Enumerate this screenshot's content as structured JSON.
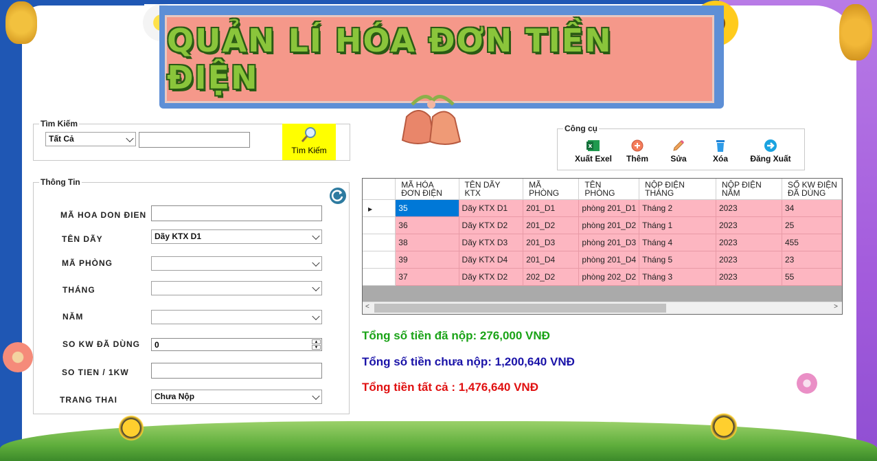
{
  "banner": {
    "title": "QUẢN LÍ HÓA ĐƠN TIỀN ĐIỆN"
  },
  "search": {
    "group_title": "Tìm Kiếm",
    "filter_value": "Tất Cả",
    "query_value": "",
    "button_label": "Tìm Kiếm"
  },
  "info": {
    "group_title": "Thông Tin",
    "fields": {
      "ma_hoa_don_label": "MÃ HOA DON ĐIEN",
      "ma_hoa_don_value": "",
      "ten_day_label": "TÊN DÃY",
      "ten_day_value": "Dãy KTX D1",
      "ma_phong_label": "MÃ PHÒNG",
      "ma_phong_value": "",
      "thang_label": "THÁNG",
      "thang_value": "",
      "nam_label": "NĂM",
      "nam_value": "",
      "so_kw_label": "SO KW ĐÃ DÙNG",
      "so_kw_value": "0",
      "so_tien_label": "SO TIEN / 1KW",
      "so_tien_value": "",
      "trang_thai_label": "TRANG THAI",
      "trang_thai_value": "Chưa Nộp"
    }
  },
  "tools": {
    "group_title": "Công cụ",
    "export": "Xuất Exel",
    "add": "Thêm",
    "edit": "Sửa",
    "delete": "Xóa",
    "logout": "Đăng Xuất"
  },
  "grid": {
    "headers": [
      "MÃ HÓA\nĐƠN ĐIỆN",
      "TÊN DÃY\nKTX",
      "MÃ\nPHÒNG",
      "TÊN\nPHÒNG",
      "NỘP ĐIỆN\nTHÁNG",
      "NỘP ĐIỆN\nNĂM",
      "SỐ KW ĐIỆN\nĐÃ DÙNG"
    ],
    "rows": [
      [
        "35",
        "Dãy KTX D1",
        "201_D1",
        "phòng 201_D1",
        "Tháng 2",
        "2023",
        "34"
      ],
      [
        "36",
        "Dãy KTX D2",
        "201_D2",
        "phòng 201_D2",
        "Tháng 1",
        "2023",
        "25"
      ],
      [
        "38",
        "Dãy KTX D3",
        "201_D3",
        "phòng 201_D3",
        "Tháng 4",
        "2023",
        "455"
      ],
      [
        "39",
        "Dãy KTX D4",
        "201_D4",
        "phòng 201_D4",
        "Tháng 5",
        "2023",
        "23"
      ],
      [
        "37",
        "Dãy KTX D2",
        "202_D2",
        "phòng 202_D2",
        "Tháng 3",
        "2023",
        "55"
      ]
    ]
  },
  "totals": {
    "paid": "Tổng số tiền đã nộp: 276,000 VNĐ",
    "unpaid": "Tổng số tiền chưa nộp: 1,200,640 VNĐ",
    "all": "Tổng tiền tất cả : 1,476,640 VNĐ"
  },
  "colors": {
    "paid": "#1aa317",
    "unpaid": "#1a13a8",
    "all": "#e01010",
    "row_bg": "#fdb6c1",
    "selected": "#0078d7",
    "search_button": "#ffff00"
  }
}
